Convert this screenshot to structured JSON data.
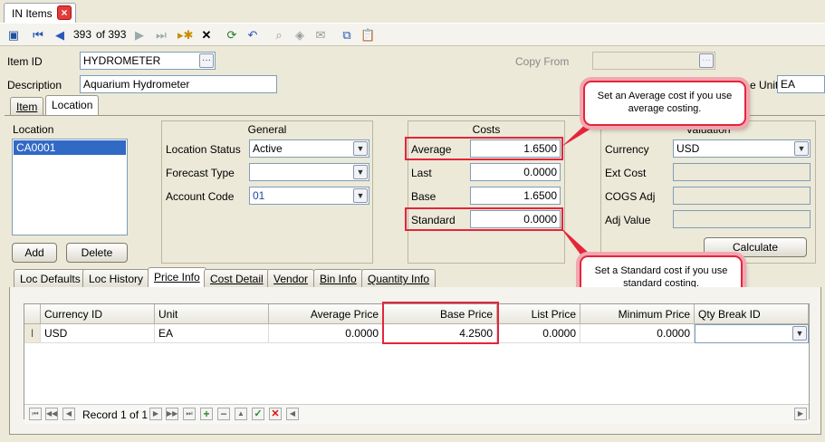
{
  "window": {
    "tab_title": "IN Items"
  },
  "toolbar": {
    "record_position": "393",
    "record_total": "of 393"
  },
  "header": {
    "item_id_label": "Item ID",
    "item_id": "HYDROMETER",
    "copy_from_label": "Copy From",
    "copy_from": "",
    "description_label": "Description",
    "description": "Aquarium Hydrometer",
    "unit_label": "e Unit",
    "unit": "EA"
  },
  "top_tabs": [
    "Item",
    "Location"
  ],
  "location": {
    "title": "Location",
    "items": [
      "CA0001"
    ],
    "add_label": "Add",
    "delete_label": "Delete"
  },
  "general": {
    "title": "General",
    "status_label": "Location Status",
    "status": "Active",
    "forecast_label": "Forecast Type",
    "forecast": "",
    "account_label": "Account Code",
    "account": "01"
  },
  "costs": {
    "title": "Costs",
    "average_label": "Average",
    "average": "1.6500",
    "last_label": "Last",
    "last": "0.0000",
    "base_label": "Base",
    "base": "1.6500",
    "standard_label": "Standard",
    "standard": "0.0000"
  },
  "valuation": {
    "title": "Valuation",
    "currency_label": "Currency",
    "currency": "USD",
    "ext_cost_label": "Ext Cost",
    "cogs_label": "COGS Adj",
    "adj_value_label": "Adj Value",
    "calculate_label": "Calculate"
  },
  "callouts": {
    "average": "Set an Average cost if you use average costing.",
    "standard": "Set a Standard cost if you use standard costing."
  },
  "sub_tabs": [
    "Loc Defaults",
    "Loc History",
    "Price Info",
    "Cost Detail",
    "Vendor",
    "Bin Info",
    "Quantity Info"
  ],
  "price_grid": {
    "columns": [
      "Currency ID",
      "Unit",
      "Average Price",
      "Base Price",
      "List Price",
      "Minimum Price",
      "Qty Break ID"
    ],
    "rows": [
      [
        "USD",
        "EA",
        "0.0000",
        "4.2500",
        "0.0000",
        "0.0000",
        ""
      ]
    ],
    "record_text": "Record 1 of 1"
  },
  "colors": {
    "highlight": "#e4253b",
    "selection": "#316ac5"
  }
}
